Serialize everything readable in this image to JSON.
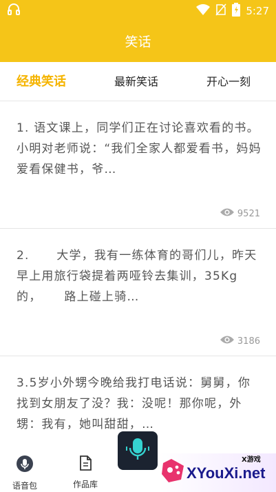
{
  "status_bar": {
    "time": "5:27",
    "notification_icon": "headset-icon",
    "icons": [
      "wifi-icon",
      "no-sim-icon",
      "battery-icon"
    ]
  },
  "header": {
    "title": "笑话"
  },
  "tabs": [
    {
      "label": "经典笑话",
      "active": true
    },
    {
      "label": "最新笑话",
      "active": false
    },
    {
      "label": "开心一刻",
      "active": false
    }
  ],
  "jokes": [
    {
      "text": "1. 语文课上，同学们正在讨论喜欢看的书。 小明对老师说：“我们全家人都爱看书，妈妈爱看保健书，爷…",
      "views": "9521"
    },
    {
      "text": "2.      大学，我有一练体育的哥们儿，昨天早上用旅行袋提着两哑铃去集训，35Kg的，     路上碰上骑…",
      "views": "3186"
    },
    {
      "text": "3.5岁小外甥今晚给我打电话说：舅舅，你找到女朋友了没？我：没呢！那你呢，外甥：我有，她叫甜甜，…"
    }
  ],
  "bottom_nav": {
    "items": [
      {
        "label": "语音包",
        "icon": "mic-circle-icon"
      },
      {
        "label": "作品库",
        "icon": "document-icon"
      }
    ],
    "center_button_icon": "microphone-icon"
  },
  "watermark": {
    "small_text": "X游戏",
    "big_text": "XYouXi.net"
  },
  "colors": {
    "accent": "#f5c518",
    "active_tab": "#f5b400"
  }
}
